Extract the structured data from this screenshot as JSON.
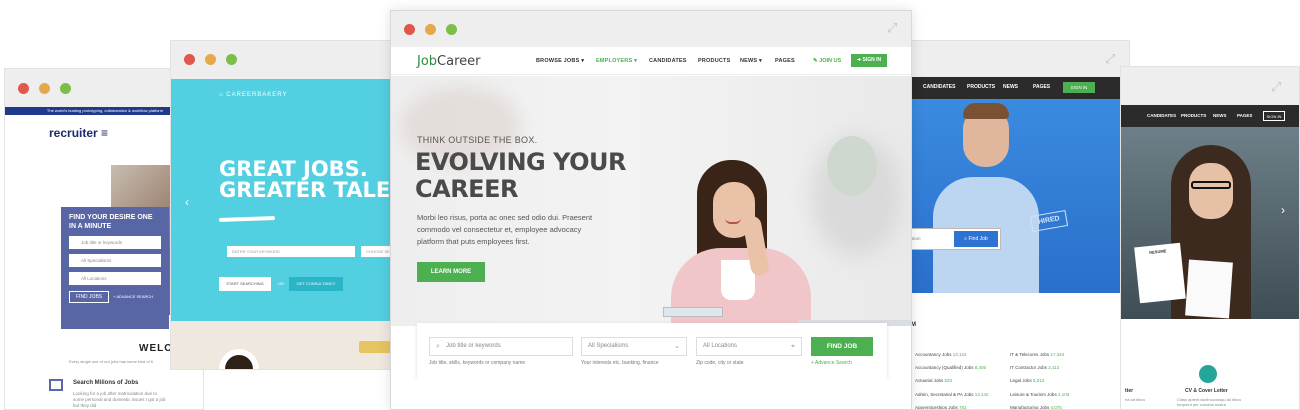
{
  "recruiter": {
    "strip": "The world's leading prototyping, collaboration & workflow platform",
    "logo": "recruiter",
    "panel_title": "FIND YOUR DESIRE ONE IN A MINUTE",
    "field1": "Job title or keywords",
    "field2": "All Specialisms",
    "field3": "All Locations",
    "find": "FIND JOBS",
    "adv": "+ ADVANCE SEARCH",
    "welcome": "WELCO",
    "sub": "Every single one of our jobs has some kind of fl",
    "feature_title": "Search Milions of Jobs",
    "feature_desc": "Looking for a job after matriculation due to some personal and domestic issues I got a job but they did"
  },
  "bakery": {
    "logo": "CAREERBAKERY",
    "headline1": "GREAT JOBS.",
    "headline2": "GREATER TALEN",
    "keyword": "ENTER YOUR KEYWORD",
    "choose": "CHOOSE SEC",
    "start": "START SEARCHING",
    "or": "OR",
    "consult": "GET CONSULTANCY"
  },
  "main": {
    "brand_a": "Job",
    "brand_b": "Career",
    "nav": [
      "BROWSE JOBS",
      "EMPLOYERS",
      "CANDIDATES",
      "PRODUCTS",
      "NEWS",
      "PAGES"
    ],
    "join": "JOIN US",
    "signin": "SIGN IN",
    "kicker": "THINK OUTSIDE THE BOX.",
    "title1": "EVOLVING YOUR",
    "title2": "CAREER",
    "desc": "Morbi leo risus, porta ac onec sed odio dui. Praesent commodo vel consectetur et,  employee advocacy platform that puts employees first.",
    "learn": "LEARN MORE",
    "search": {
      "keyword_placeholder": "Job title or keywords",
      "keyword_hint": "Job title, skills, keywords or company name",
      "specialism": "All Specialisms",
      "specialism_hint": "Your interests etc. banking, finance",
      "location": "All Locations",
      "location_hint": "Zip code, city or state",
      "find": "FIND JOB",
      "advance": "+ Advance Search"
    },
    "accent": "#4caf50"
  },
  "blue": {
    "nav": [
      "CANDIDATES",
      "PRODUCTS",
      "NEWS",
      "PAGES"
    ],
    "signin": "SIGN IN",
    "location": "ocation",
    "find": "Find Job",
    "hired": "HIRED",
    "section": "SM",
    "jobs": [
      {
        "name": "Accountancy Jobs",
        "count": "13,122"
      },
      {
        "name": "Accountancy (Qualified) Jobs",
        "count": "8,405"
      },
      {
        "name": "Actuarial Jobs",
        "count": "533"
      },
      {
        "name": "Admin, Secretarial & PA Jobs",
        "count": "13,142"
      },
      {
        "name": "Apprenticeships Jobs",
        "count": "781"
      },
      {
        "name": "IT & Telecoms Jobs",
        "count": "17,324"
      },
      {
        "name": "IT Contractor Jobs",
        "count": "2,113"
      },
      {
        "name": "Legal Jobs",
        "count": "5,313"
      },
      {
        "name": "Leisure & Tourism Jobs",
        "count": "2,103"
      },
      {
        "name": "Manufacturing Jobs",
        "count": "4,075"
      }
    ]
  },
  "far": {
    "nav": [
      "CANDIDATES",
      "PRODUCTS",
      "NEWS",
      "PAGES"
    ],
    "signin": "SIGN IN",
    "resume": "RESUME",
    "cv_title": "CV & Cover Letter",
    "cv_desc": "Class aptent taciti sociosqu ad litora torquent per conubia nostra",
    "left_title": "tter",
    "left_desc": "ea ad litora"
  }
}
